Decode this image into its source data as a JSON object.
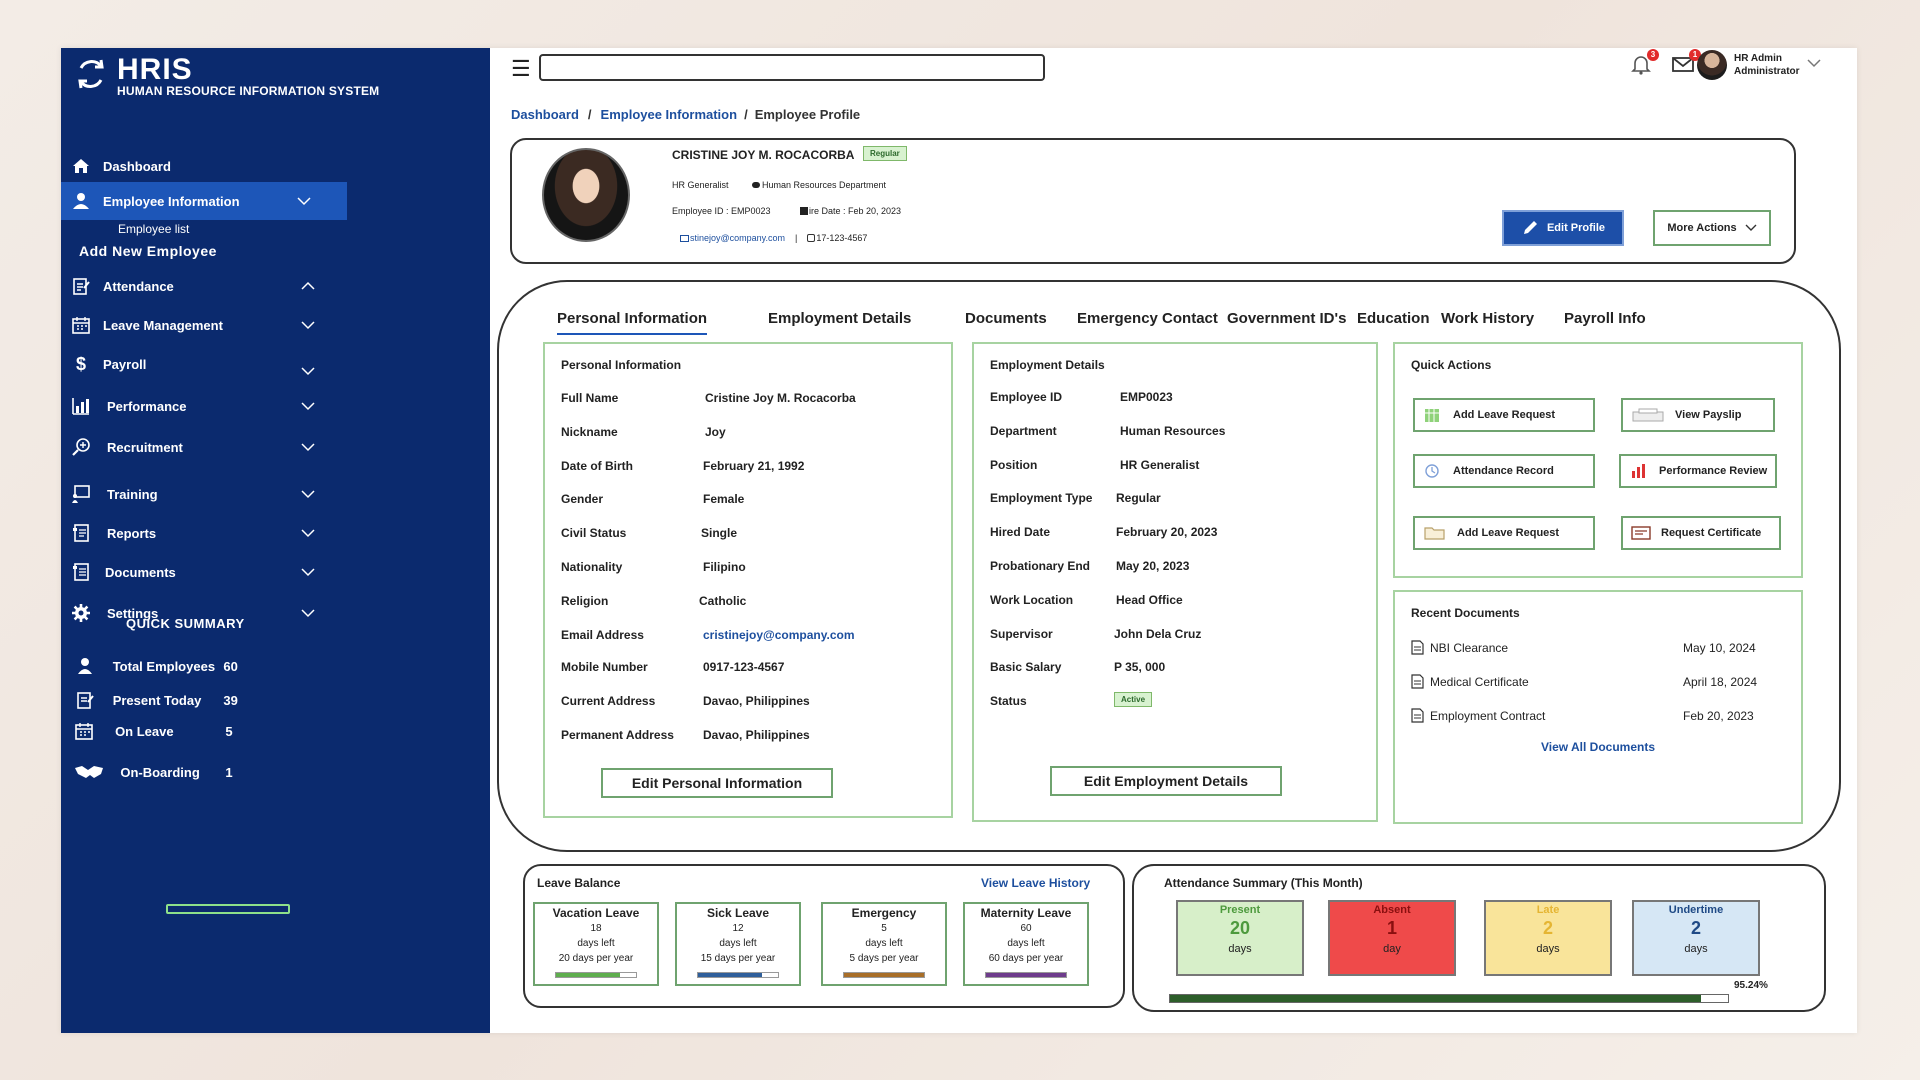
{
  "app": {
    "title": "HRIS",
    "subtitle": "HUMAN RESOURCE INFORMATION SYSTEM"
  },
  "sidebar": {
    "items": [
      {
        "label": "Dashboard"
      },
      {
        "label": "Employee Information"
      },
      {
        "label": "Attendance"
      },
      {
        "label": "Leave Management"
      },
      {
        "label": "Payroll"
      },
      {
        "label": "Performance"
      },
      {
        "label": "Recruitment"
      },
      {
        "label": "Training"
      },
      {
        "label": "Reports"
      },
      {
        "label": "Documents"
      },
      {
        "label": "Settings"
      }
    ],
    "sub_items": {
      "employee_list": "Employee list",
      "add_new_employee": "Add New Employee"
    },
    "quick_summary": {
      "title": "QUICK SUMMARY",
      "rows": [
        {
          "label": "Total Employees",
          "value": "60"
        },
        {
          "label": "Present Today",
          "value": "39"
        },
        {
          "label": "On Leave",
          "value": "5"
        },
        {
          "label": "On-Boarding",
          "value": "1"
        }
      ]
    }
  },
  "topbar": {
    "notifications_count": "3",
    "messages_count": "1",
    "user_name": "HR Admin",
    "user_role": "Administrator"
  },
  "breadcrumb": {
    "items": [
      "Dashboard",
      "Employee Information"
    ],
    "current": "Employee Profile"
  },
  "profile": {
    "name": "CRISTINE JOY M. ROCACORBA",
    "badge": "Regular",
    "position": "HR Generalist",
    "department": "Human Resources Department",
    "employee_id": "Employee ID :  EMP0023",
    "hire_date": "ire Date : Feb 20, 2023",
    "email": "stinejoy@company.com",
    "separator": "|",
    "phone": "17-123-4567",
    "edit_profile": "Edit Profile",
    "more_actions": "More Actions"
  },
  "tabs": [
    "Personal Information",
    "Employment Details",
    "Documents",
    "Emergency Contact",
    "Government ID's",
    "Education",
    "Work History",
    "Payroll Info"
  ],
  "personal_info": {
    "title": "Personal Information",
    "fields": [
      {
        "label": "Full Name",
        "value": "Cristine Joy M. Rocacorba"
      },
      {
        "label": "Nickname",
        "value": "Joy"
      },
      {
        "label": "Date of Birth",
        "value": "February 21, 1992"
      },
      {
        "label": "Gender",
        "value": "Female"
      },
      {
        "label": "Civil Status",
        "value": "Single"
      },
      {
        "label": "Nationality",
        "value": "Filipino"
      },
      {
        "label": "Religion",
        "value": "Catholic"
      },
      {
        "label": "Email Address",
        "value": "cristinejoy@company.com"
      },
      {
        "label": "Mobile Number",
        "value": "0917-123-4567"
      },
      {
        "label": "Current Address",
        "value": "Davao, Philippines"
      },
      {
        "label": "Permanent Address",
        "value": "Davao, Philippines"
      }
    ],
    "edit_button": "Edit Personal Information"
  },
  "employment_details": {
    "title": "Employment Details",
    "fields": [
      {
        "label": "Employee ID",
        "value": "EMP0023"
      },
      {
        "label": "Department",
        "value": "Human Resources"
      },
      {
        "label": "Position",
        "value": "HR Generalist"
      },
      {
        "label": "Employment Type",
        "value": "Regular"
      },
      {
        "label": "Hired Date",
        "value": "February 20, 2023"
      },
      {
        "label": "Probationary End",
        "value": "May 20, 2023"
      },
      {
        "label": "Work Location",
        "value": "Head Office"
      },
      {
        "label": "Supervisor",
        "value": "John Dela Cruz"
      },
      {
        "label": "Basic Salary",
        "value": "P 35, 000"
      },
      {
        "label": "Status",
        "value": "Active"
      }
    ],
    "edit_button": "Edit Employment Details"
  },
  "quick_actions": {
    "title": "Quick Actions",
    "buttons": [
      {
        "label": "Add Leave Request",
        "icon": "calendar-icon"
      },
      {
        "label": "View Payslip",
        "icon": "payslip-icon"
      },
      {
        "label": "Attendance Record",
        "icon": "clock-icon"
      },
      {
        "label": "Performance Review",
        "icon": "bar-chart-icon"
      },
      {
        "label": "Add Leave Request",
        "icon": "folder-icon"
      },
      {
        "label": "Request Certificate",
        "icon": "certificate-icon"
      }
    ]
  },
  "recent_documents": {
    "title": "Recent Documents",
    "items": [
      {
        "name": "NBI Clearance",
        "date": "May 10, 2024"
      },
      {
        "name": "Medical Certificate",
        "date": "April 18, 2024"
      },
      {
        "name": "Employment Contract",
        "date": "Feb 20, 2023"
      }
    ],
    "view_all": "View All Documents"
  },
  "leave_balance": {
    "title": "Leave Balance",
    "view_history": "View Leave History",
    "tiles": [
      {
        "name": "Vacation Leave",
        "count": "18",
        "left": "days left",
        "per_year": "20 days per year",
        "color": "#5fae4e",
        "fraction": 0.8
      },
      {
        "name": "Sick Leave",
        "count": "12",
        "left": "days left",
        "per_year": "15 days per year",
        "color": "#2f5f9a",
        "fraction": 0.8
      },
      {
        "name": "Emergency",
        "count": "5",
        "left": "days left",
        "per_year": "5 days per year",
        "color": "#a86e28",
        "fraction": 1.0
      },
      {
        "name": "Maternity Leave",
        "count": "60",
        "left": "days left",
        "per_year": "60 days per year",
        "color": "#6e3c8c",
        "fraction": 1.0
      }
    ]
  },
  "attendance_summary": {
    "title": "Attendance Summary (This Month)",
    "tiles": [
      {
        "label": "Present",
        "value": "20",
        "unit": "days",
        "bg": "#d7efc9",
        "fg": "#4d9a3d"
      },
      {
        "label": "Absent",
        "value": "1",
        "unit": "day",
        "bg": "#ef4a4a",
        "fg": "#8a0f0f"
      },
      {
        "label": "Late",
        "value": "2",
        "unit": "days",
        "bg": "#f9e49a",
        "fg": "#e5b533"
      },
      {
        "label": "Undertime",
        "value": "2",
        "unit": "days",
        "bg": "#d6e7f5",
        "fg": "#1f4a86"
      }
    ],
    "rate_label": "95.24%",
    "rate_fraction": 0.9524
  }
}
